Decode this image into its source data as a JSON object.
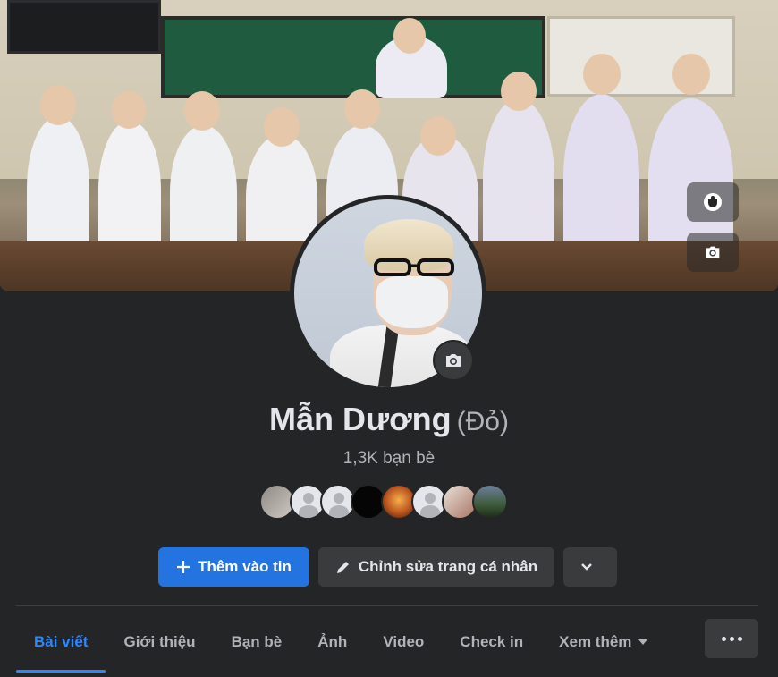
{
  "profile": {
    "name": "Mẫn Dương",
    "alternate_name": "(Đỏ)",
    "friends_count": "1,3K bạn bè"
  },
  "actions": {
    "add_story_label": "Thêm vào tin",
    "edit_profile_label": "Chỉnh sửa trang cá nhân"
  },
  "tabs": [
    {
      "label": "Bài viết",
      "active": true
    },
    {
      "label": "Giới thiệu",
      "active": false
    },
    {
      "label": "Bạn bè",
      "active": false
    },
    {
      "label": "Ảnh",
      "active": false
    },
    {
      "label": "Video",
      "active": false
    },
    {
      "label": "Check in",
      "active": false
    },
    {
      "label": "Xem thêm",
      "active": false
    }
  ],
  "icons": {
    "cover_top": "avatar-edit-icon",
    "cover_bottom": "camera-icon",
    "avatar": "camera-icon",
    "add_story": "plus-icon",
    "edit_profile": "pencil-icon",
    "more": "chevron-down-icon",
    "tab_menu": "more-horizontal-icon"
  },
  "colors": {
    "accent": "#2374e1",
    "active_tab": "#2d88ff",
    "surface": "#242526",
    "button_secondary": "#3a3b3c"
  }
}
